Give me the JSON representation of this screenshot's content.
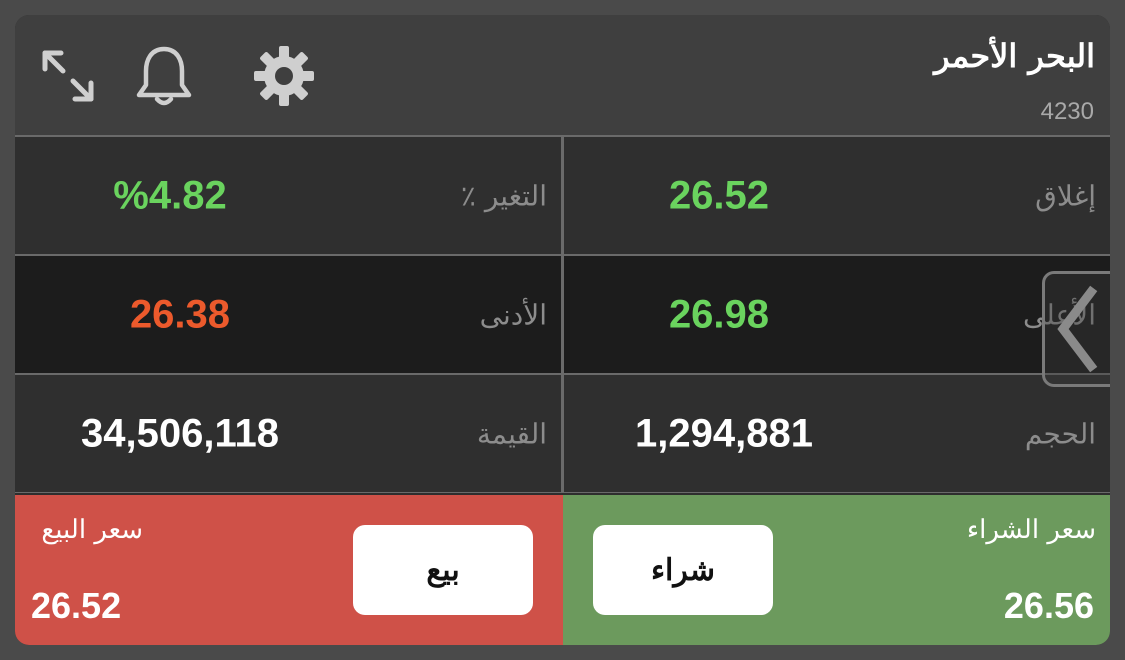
{
  "header": {
    "title": "البحر الأحمر",
    "symbol": "4230",
    "icons": [
      "expand-icon",
      "bell-icon",
      "gear-icon"
    ]
  },
  "stats": {
    "close": {
      "label": "إغلاق",
      "value": "26.52"
    },
    "change_pct": {
      "label": "التغير ٪",
      "value": "%4.82"
    },
    "high": {
      "label": "الأعلى",
      "value": "26.98"
    },
    "low": {
      "label": "الأدنى",
      "value": "26.38"
    },
    "volume": {
      "label": "الحجم",
      "value": "1,294,881"
    },
    "value": {
      "label": "القيمة",
      "value": "34,506,118"
    }
  },
  "sell": {
    "label": "سعر البيع",
    "price": "26.52",
    "button_label": "بيع"
  },
  "buy": {
    "label": "سعر الشراء",
    "price": "26.56",
    "button_label": "شراء"
  },
  "colors": {
    "up": "#6ad35e",
    "down": "#ec5a2c",
    "sell_bg": "#cf5148",
    "buy_bg": "#6c9a5d",
    "card_bg": "#2e2e2e",
    "header_bg": "#3f3f3f"
  }
}
